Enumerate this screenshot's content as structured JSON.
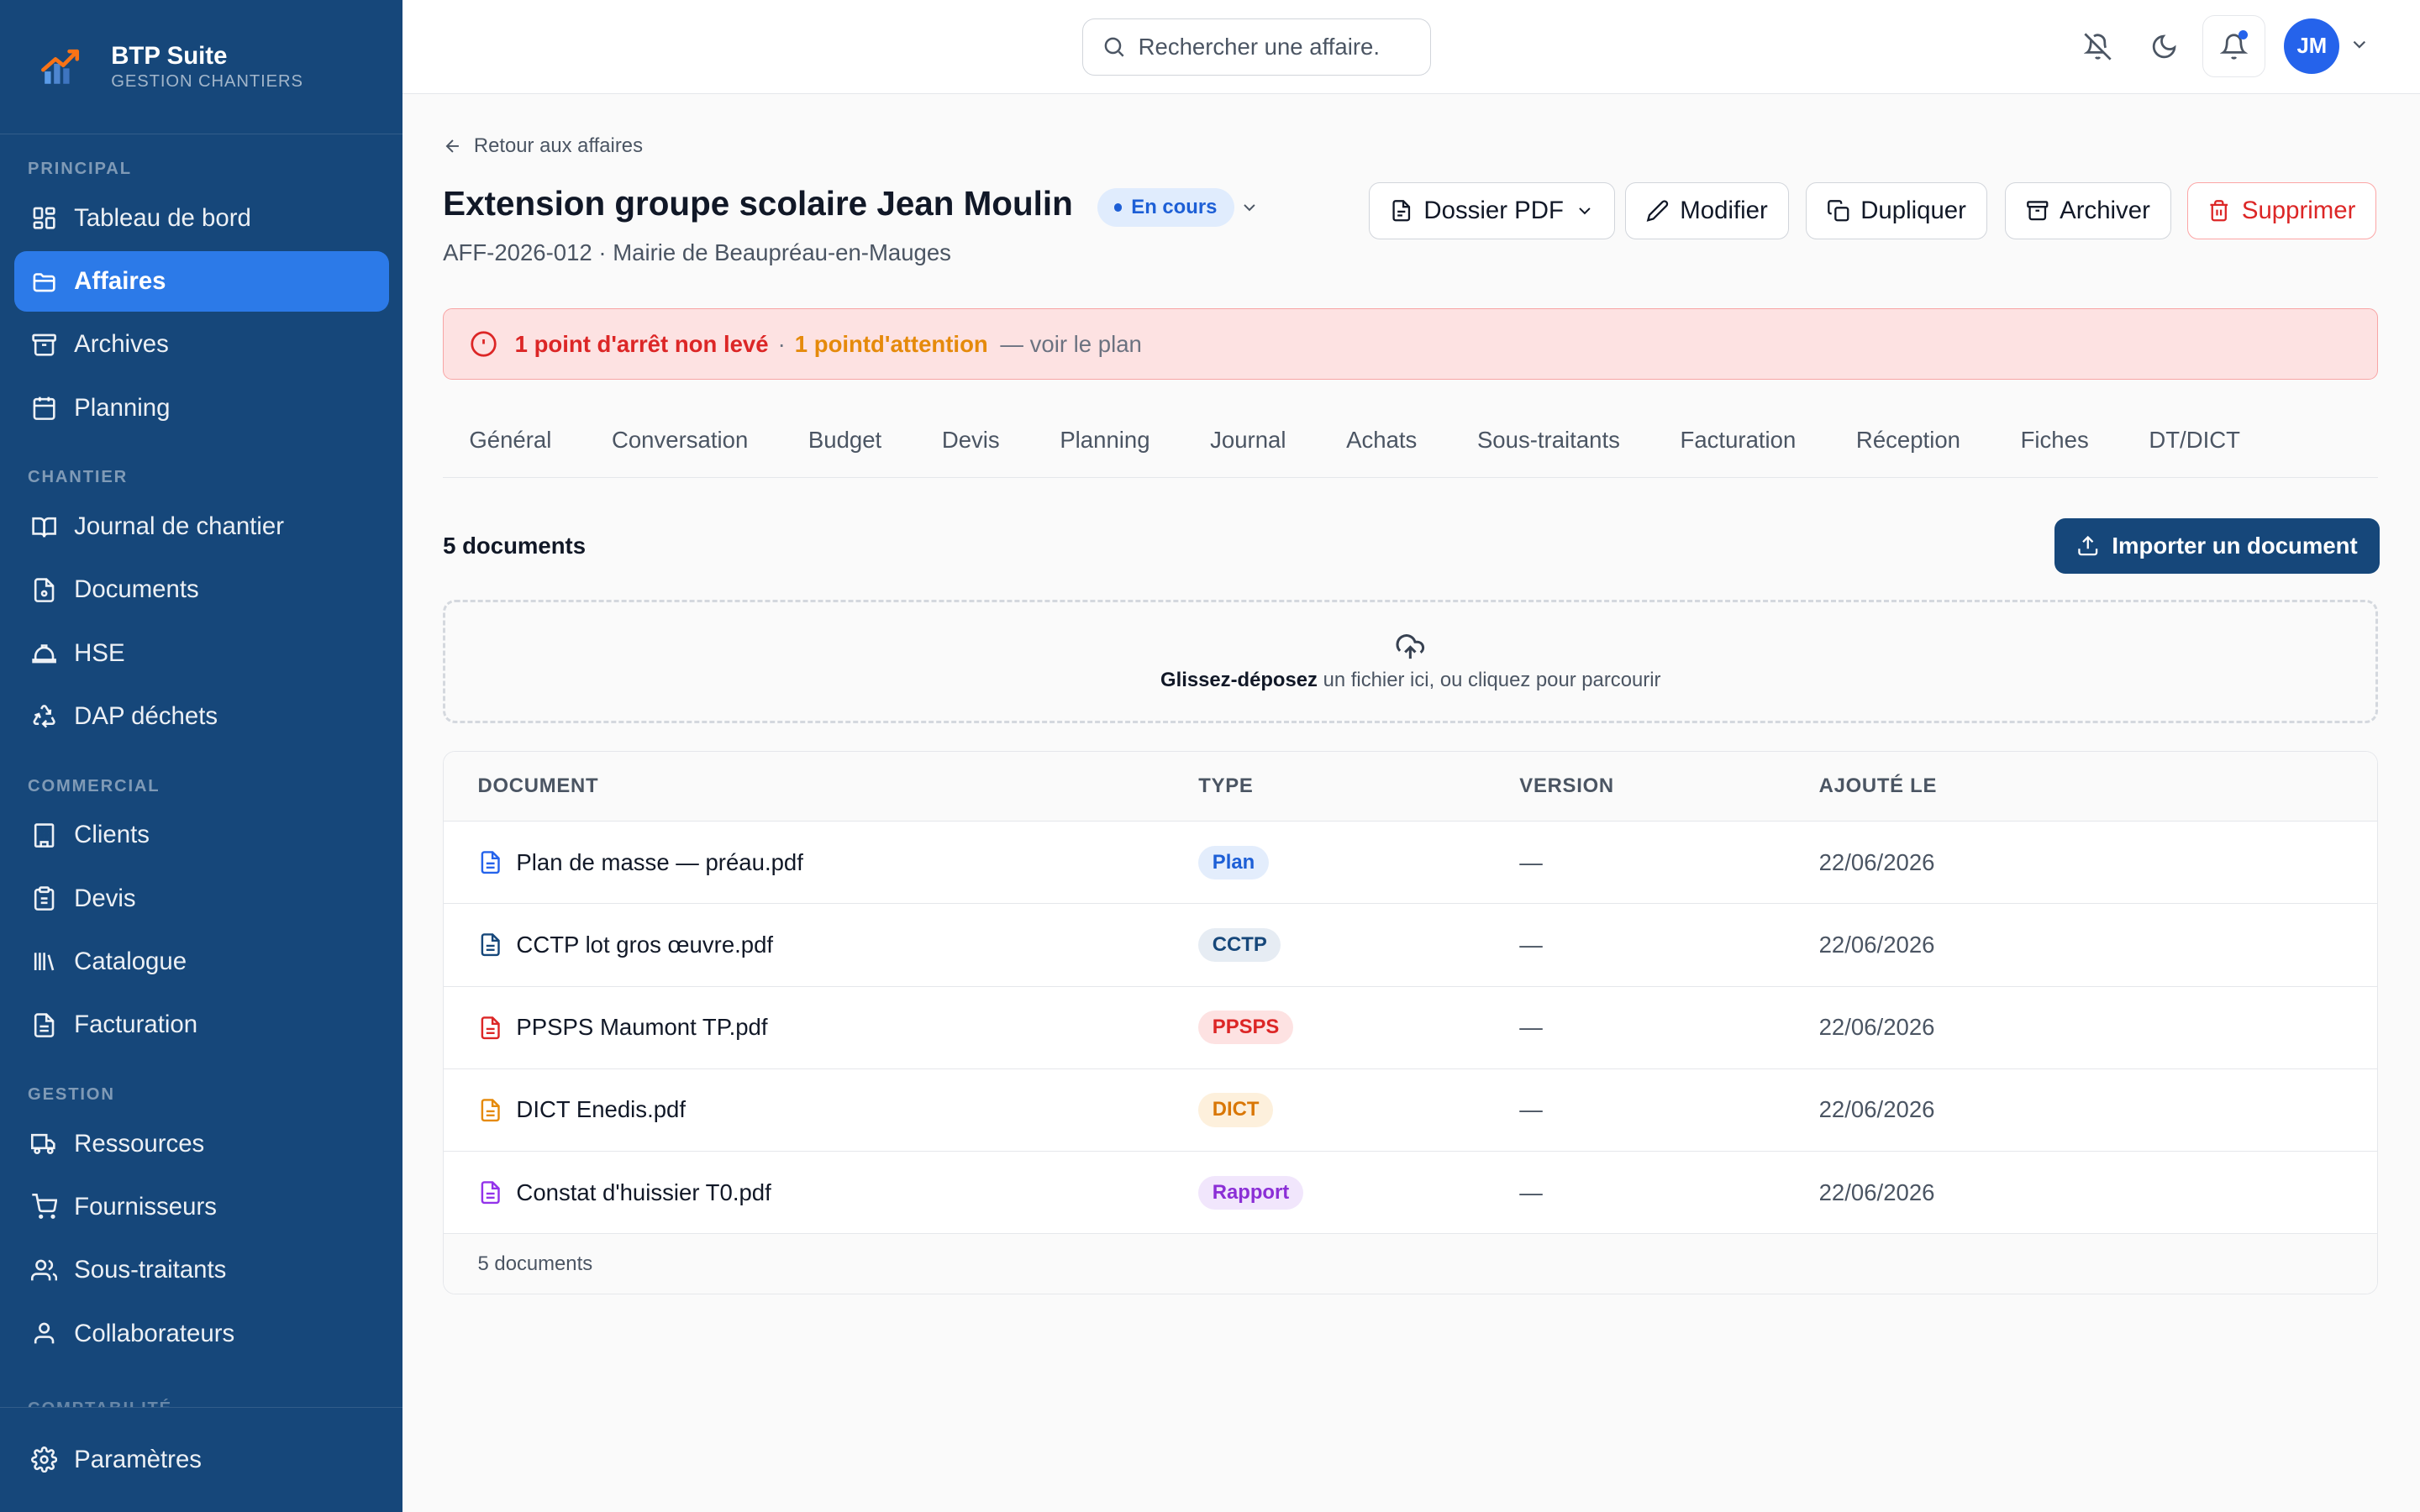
{
  "brand": {
    "title": "BTP Suite",
    "subtitle": "GESTION CHANTIERS"
  },
  "sidebar": {
    "sections": [
      {
        "label": "PRINCIPAL",
        "items": [
          "Tableau de bord",
          "Affaires",
          "Archives",
          "Planning"
        ]
      },
      {
        "label": "CHANTIER",
        "items": [
          "Journal de chantier",
          "Documents",
          "HSE",
          "DAP déchets"
        ]
      },
      {
        "label": "COMMERCIAL",
        "items": [
          "Clients",
          "Devis",
          "Catalogue",
          "Facturation"
        ]
      },
      {
        "label": "GESTION",
        "items": [
          "Ressources",
          "Fournisseurs",
          "Sous-traitants",
          "Collaborateurs"
        ]
      }
    ],
    "cut_section": "COMPTABILITÉ",
    "active": "Affaires",
    "footer_item": "Paramètres"
  },
  "topbar": {
    "search_placeholder": "Rechercher une affaire.",
    "avatar_initials": "JM",
    "accent": "#2563eb"
  },
  "page": {
    "back_label": "Retour aux affaires",
    "title": "Extension groupe scolaire Jean Moulin",
    "status": "En cours",
    "subtitle": "AFF-2026-012 · Mairie de Beaupréau-en-Mauges",
    "actions": {
      "pdf": "Dossier PDF",
      "edit": "Modifier",
      "duplicate": "Dupliquer",
      "archive": "Archiver",
      "delete": "Supprimer"
    }
  },
  "alert": {
    "stop_points": "1 point d'arrêt non levé",
    "separator": "·",
    "attention": "1 pointd'attention",
    "link": "— voir le plan"
  },
  "tabs": [
    "Général",
    "Conversation",
    "Budget",
    "Devis",
    "Planning",
    "Journal",
    "Achats",
    "Sous-traitants",
    "Facturation",
    "Réception",
    "Fiches",
    "DT/DICT"
  ],
  "documents": {
    "count_label": "5 documents",
    "import_label": "Importer un document",
    "dropzone_bold": "Glissez-déposez",
    "dropzone_text": " un fichier ici, ou cliquez pour parcourir",
    "columns": [
      "DOCUMENT",
      "TYPE",
      "VERSION",
      "AJOUTÉ LE"
    ],
    "rows": [
      {
        "name": "Plan de masse — préau.pdf",
        "type": "Plan",
        "version": "—",
        "date": "22/06/2026",
        "icon_color": "#2563eb",
        "badge_bg": "#e3edfc",
        "badge_fg": "#1d5fd6"
      },
      {
        "name": "CCTP lot gros œuvre.pdf",
        "type": "CCTP",
        "version": "—",
        "date": "22/06/2026",
        "icon_color": "#16477a",
        "badge_bg": "#e6ecf3",
        "badge_fg": "#16477a"
      },
      {
        "name": "PPSPS Maumont TP.pdf",
        "type": "PPSPS",
        "version": "—",
        "date": "22/06/2026",
        "icon_color": "#dc2626",
        "badge_bg": "#fde2e2",
        "badge_fg": "#dc2626"
      },
      {
        "name": "DICT Enedis.pdf",
        "type": "DICT",
        "version": "—",
        "date": "22/06/2026",
        "icon_color": "#e58a0b",
        "badge_bg": "#fdf0dc",
        "badge_fg": "#d97706"
      },
      {
        "name": "Constat d'huissier T0.pdf",
        "type": "Rapport",
        "version": "—",
        "date": "22/06/2026",
        "icon_color": "#9333ea",
        "badge_bg": "#f1e6fc",
        "badge_fg": "#8b2fd6"
      }
    ],
    "footer_label": "5 documents"
  }
}
